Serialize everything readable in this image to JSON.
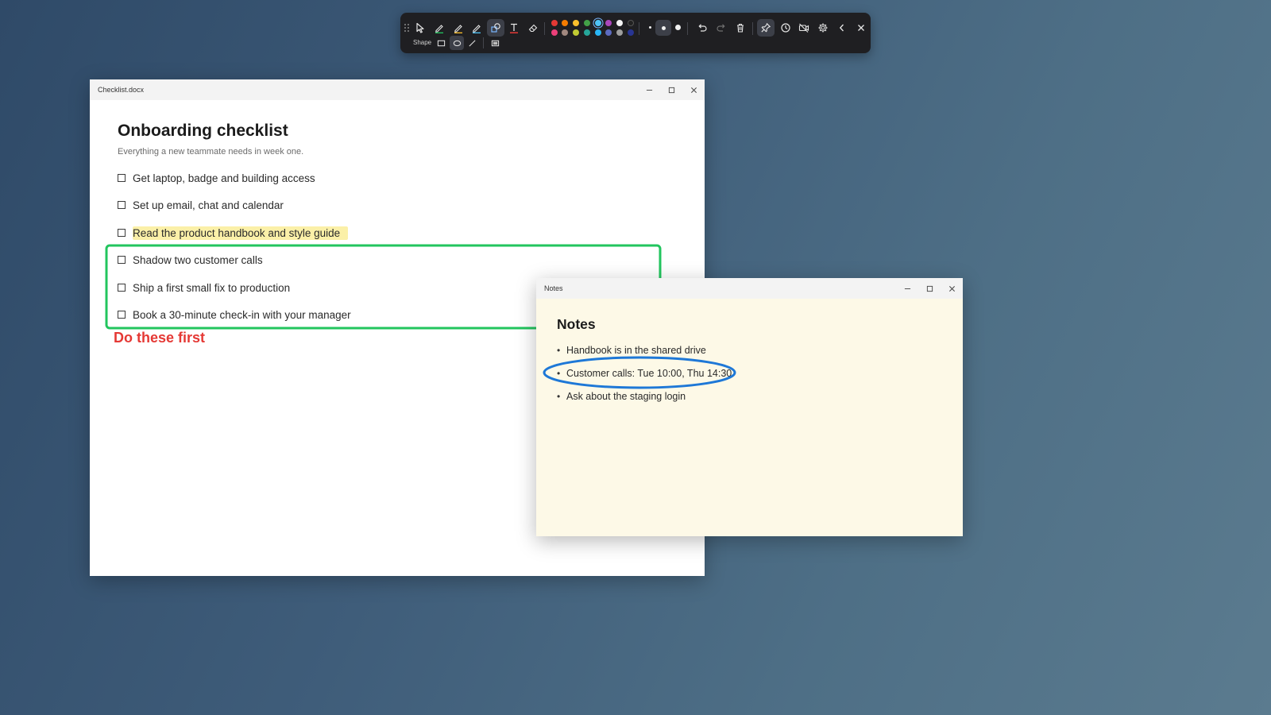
{
  "toolbar": {
    "tools": [
      {
        "name": "drag-handle-icon"
      },
      {
        "name": "select-cursor-icon"
      },
      {
        "name": "pen-green-icon"
      },
      {
        "name": "highlighter-yellow-icon"
      },
      {
        "name": "pen-blue-icon"
      },
      {
        "name": "shape-tool-icon",
        "active": true
      },
      {
        "name": "text-tool-icon"
      },
      {
        "name": "eraser-icon"
      }
    ],
    "colors_row1": [
      "#e53935",
      "#f57c00",
      "#fbc02d",
      "#43a047",
      "#4fc3f7",
      "#ab47bc",
      "#f5f5f5",
      "#212121"
    ],
    "colors_row2": [
      "#ec407a",
      "#a1887f",
      "#c0ca33",
      "#26a69a",
      "#29b6f6",
      "#5c6bc0",
      "#9e9e9e",
      "#283593"
    ],
    "selected_color": "#4fc3f7",
    "shape_label": "Shape",
    "shape_options": [
      "rectangle",
      "ellipse",
      "line",
      "filled-rectangle"
    ],
    "selected_shape": "ellipse"
  },
  "checklist_window": {
    "title": "Checklist.docx",
    "heading": "Onboarding checklist",
    "subtitle": "Everything a new teammate needs in week one.",
    "items": [
      "Get laptop, badge and building access",
      "Set up email, chat and calendar",
      "Read the product handbook and style guide",
      "Shadow two customer calls",
      "Ship a first small fix to production",
      "Book a 30-minute check-in with your manager"
    ],
    "highlighted_item": 2
  },
  "notes_window": {
    "title": "Notes",
    "heading": "Notes",
    "items": [
      "Handbook is in the shared drive",
      "Customer calls: Tue 10:00, Thu 14:30",
      "Ask about the staging login"
    ]
  },
  "annotations": {
    "callout_text": "Do these first",
    "callout_color": "#e53935",
    "box_color": "#22c55e",
    "ellipse_color": "#1e78d7",
    "highlight_color": "#fbf0a8"
  }
}
